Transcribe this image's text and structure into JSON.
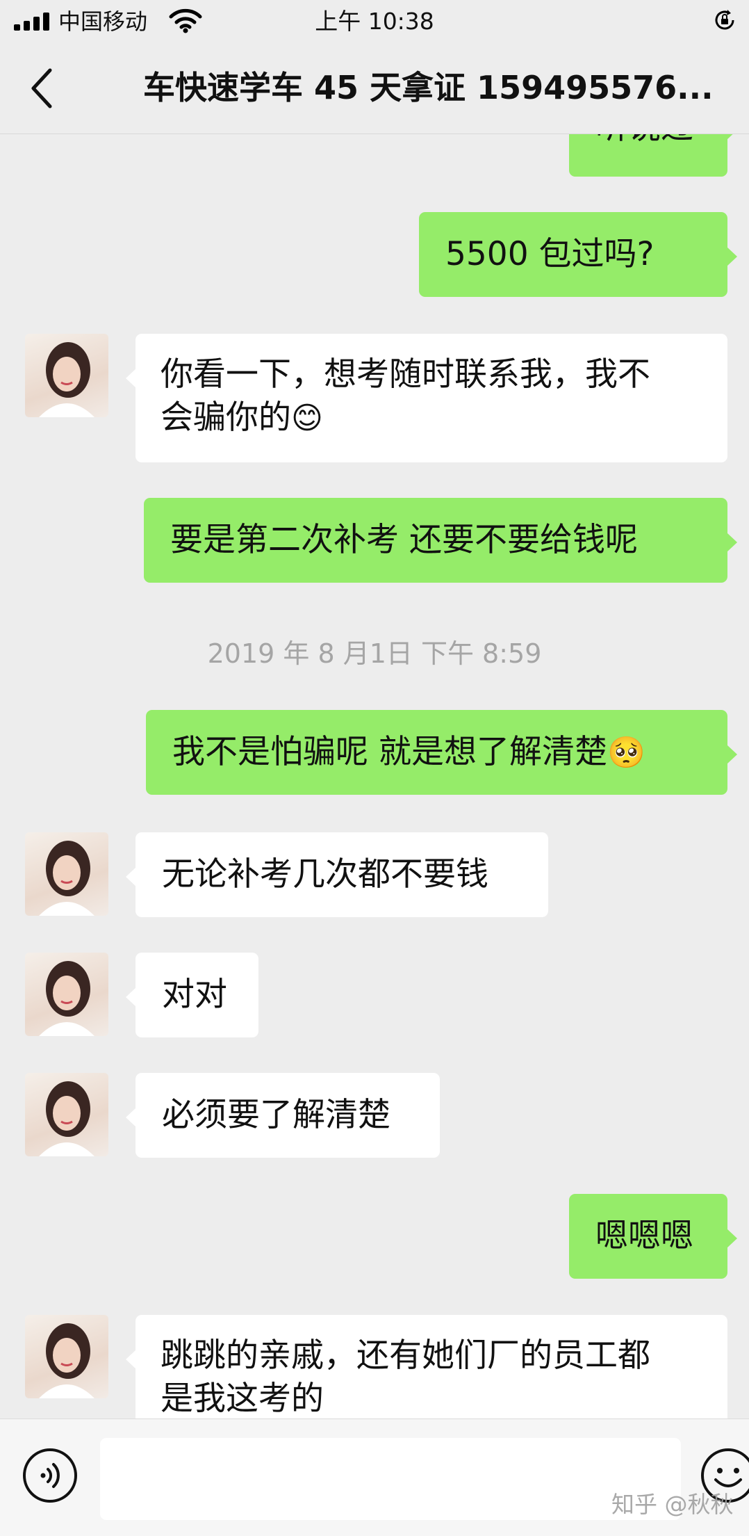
{
  "status_bar": {
    "carrier": "中国移动",
    "time": "上午 10:38"
  },
  "header": {
    "title": "车快速学车 45 天拿证 159495576..."
  },
  "messages": {
    "m0": "听说过",
    "m1": "5500  包过吗?",
    "m2_line1": "你看一下，想考随时联系我，我不",
    "m2_line2": "会骗你的",
    "m3": "要是第二次补考  还要不要给钱呢",
    "time1": "2019 年 8 月1日  下午 8:59",
    "m4": "我不是怕骗呢  就是想了解清楚",
    "m5": "无论补考几次都不要钱",
    "m6": "对对",
    "m7": "必须要了解清楚",
    "m8": "嗯嗯嗯",
    "m9_line1": "跳跳的亲戚，还有她们厂的员工都",
    "m9_line2": "是我这考的"
  },
  "emoji": {
    "smile": "😊",
    "blush": "🥺"
  },
  "watermark": "知乎 @秋秋",
  "colors": {
    "outgoing_bubble": "#95ec69",
    "incoming_bubble": "#ffffff",
    "background": "#ededed"
  }
}
